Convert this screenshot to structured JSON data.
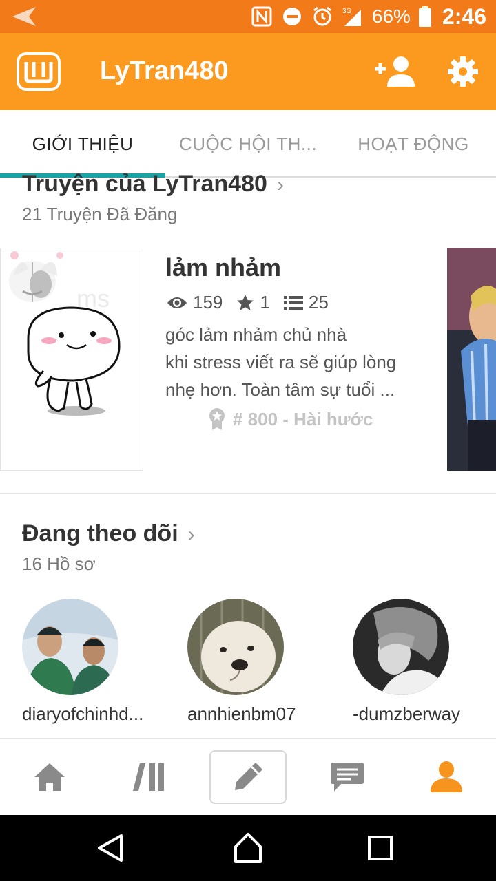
{
  "status_bar": {
    "battery": "66%",
    "time": "2:46",
    "network": "3G"
  },
  "app_bar": {
    "title": "LyTran480"
  },
  "tabs": [
    {
      "label": "GIỚI THIỆU",
      "active": true
    },
    {
      "label": "CUỘC HỘI TH...",
      "active": false
    },
    {
      "label": "HOẠT ĐỘNG",
      "active": false
    }
  ],
  "stories": {
    "title": "Truyện của LyTran480",
    "count_label": "21 Truyện Đã Đăng",
    "featured": {
      "title": "lảm nhảm",
      "views": "159",
      "votes": "1",
      "parts": "25",
      "description": [
        "góc lảm nhảm chủ nhà",
        "khi stress viết ra sẽ giúp lòng",
        "nhẹ hơn. Toàn tâm sự tuổi ..."
      ],
      "rank": "# 800 - Hài hước"
    }
  },
  "following": {
    "title": "Đang theo dõi",
    "count_label": "16 Hồ sơ",
    "profiles": [
      {
        "name": "diaryofchinhd..."
      },
      {
        "name": "annhienbm07"
      },
      {
        "name": "-dumzberway"
      }
    ]
  },
  "colors": {
    "status_bar": "#f37a19",
    "app_bar": "#fb9a1f",
    "tab_indicator": "#1aa3a3",
    "nav_active": "#f7941d",
    "nav_inactive": "#8a8a8a"
  },
  "bottom_nav": [
    {
      "icon": "home-icon",
      "active": false
    },
    {
      "icon": "library-icon",
      "active": false
    },
    {
      "icon": "pencil-icon",
      "active": false
    },
    {
      "icon": "messages-icon",
      "active": false
    },
    {
      "icon": "profile-icon",
      "active": true
    }
  ]
}
